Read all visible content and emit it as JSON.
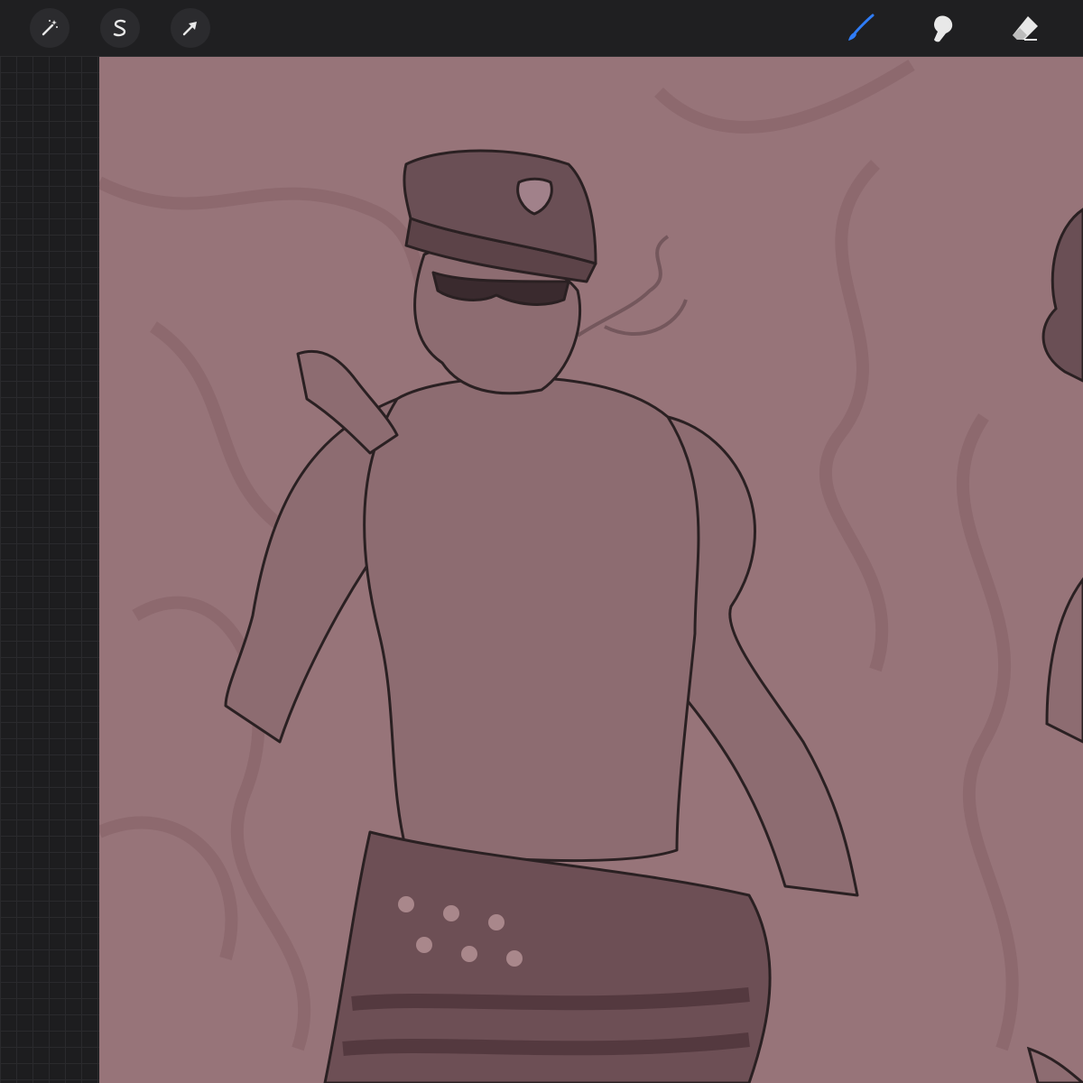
{
  "toolbar": {
    "left_tools": [
      {
        "icon": "magic-wand-icon"
      },
      {
        "icon": "selection-icon"
      },
      {
        "icon": "transform-arrow-icon"
      }
    ],
    "right_tools": [
      {
        "icon": "brush-icon",
        "active": true
      },
      {
        "icon": "smudge-icon"
      },
      {
        "icon": "eraser-icon"
      }
    ]
  },
  "colors": {
    "toolbar_bg": "#1f1f21",
    "canvas_bg": "#977479",
    "active_tool": "#2f7cf6",
    "inactive_tool": "#e8e8e8",
    "line_art": "#2a2022"
  }
}
